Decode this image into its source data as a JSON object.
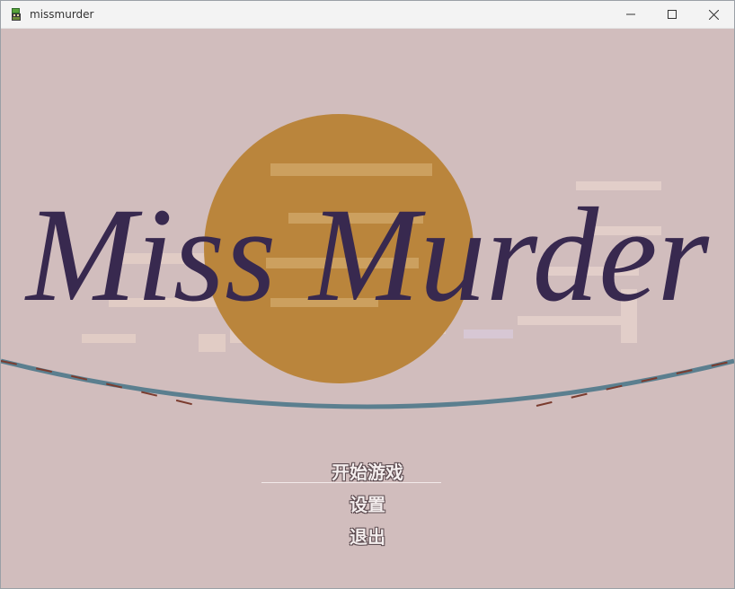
{
  "window": {
    "title": "missmurder",
    "controls": {
      "minimize_icon": "minimize-icon",
      "maximize_icon": "maximize-icon",
      "close_icon": "close-icon"
    }
  },
  "game": {
    "logo_text": "Miss Murder",
    "menu": {
      "start": "开始游戏",
      "settings": "设置",
      "exit": "退出"
    },
    "colors": {
      "background": "#d1bdbd",
      "sun": "#ba853c",
      "logo": "#38294f",
      "horizon_blue": "#5b7f8f",
      "horizon_red": "#7a3b2e"
    }
  }
}
